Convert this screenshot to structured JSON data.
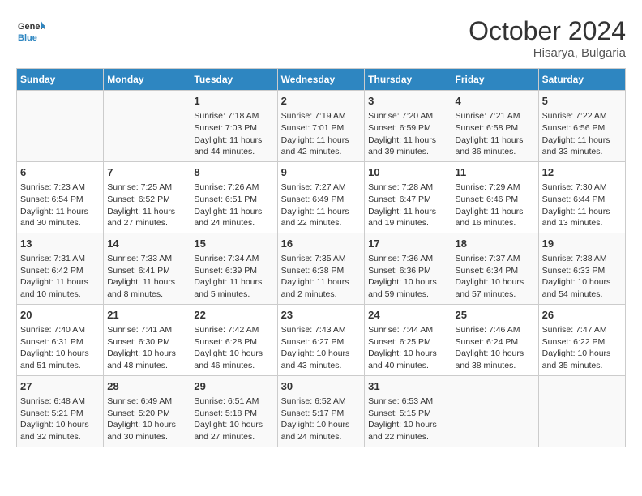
{
  "header": {
    "logo_line1": "General",
    "logo_line2": "Blue",
    "month_year": "October 2024",
    "location": "Hisarya, Bulgaria"
  },
  "days_of_week": [
    "Sunday",
    "Monday",
    "Tuesday",
    "Wednesday",
    "Thursday",
    "Friday",
    "Saturday"
  ],
  "weeks": [
    {
      "cells": [
        {
          "day": "",
          "info": ""
        },
        {
          "day": "",
          "info": ""
        },
        {
          "day": "1",
          "info": "Sunrise: 7:18 AM\nSunset: 7:03 PM\nDaylight: 11 hours and 44 minutes."
        },
        {
          "day": "2",
          "info": "Sunrise: 7:19 AM\nSunset: 7:01 PM\nDaylight: 11 hours and 42 minutes."
        },
        {
          "day": "3",
          "info": "Sunrise: 7:20 AM\nSunset: 6:59 PM\nDaylight: 11 hours and 39 minutes."
        },
        {
          "day": "4",
          "info": "Sunrise: 7:21 AM\nSunset: 6:58 PM\nDaylight: 11 hours and 36 minutes."
        },
        {
          "day": "5",
          "info": "Sunrise: 7:22 AM\nSunset: 6:56 PM\nDaylight: 11 hours and 33 minutes."
        }
      ]
    },
    {
      "cells": [
        {
          "day": "6",
          "info": "Sunrise: 7:23 AM\nSunset: 6:54 PM\nDaylight: 11 hours and 30 minutes."
        },
        {
          "day": "7",
          "info": "Sunrise: 7:25 AM\nSunset: 6:52 PM\nDaylight: 11 hours and 27 minutes."
        },
        {
          "day": "8",
          "info": "Sunrise: 7:26 AM\nSunset: 6:51 PM\nDaylight: 11 hours and 24 minutes."
        },
        {
          "day": "9",
          "info": "Sunrise: 7:27 AM\nSunset: 6:49 PM\nDaylight: 11 hours and 22 minutes."
        },
        {
          "day": "10",
          "info": "Sunrise: 7:28 AM\nSunset: 6:47 PM\nDaylight: 11 hours and 19 minutes."
        },
        {
          "day": "11",
          "info": "Sunrise: 7:29 AM\nSunset: 6:46 PM\nDaylight: 11 hours and 16 minutes."
        },
        {
          "day": "12",
          "info": "Sunrise: 7:30 AM\nSunset: 6:44 PM\nDaylight: 11 hours and 13 minutes."
        }
      ]
    },
    {
      "cells": [
        {
          "day": "13",
          "info": "Sunrise: 7:31 AM\nSunset: 6:42 PM\nDaylight: 11 hours and 10 minutes."
        },
        {
          "day": "14",
          "info": "Sunrise: 7:33 AM\nSunset: 6:41 PM\nDaylight: 11 hours and 8 minutes."
        },
        {
          "day": "15",
          "info": "Sunrise: 7:34 AM\nSunset: 6:39 PM\nDaylight: 11 hours and 5 minutes."
        },
        {
          "day": "16",
          "info": "Sunrise: 7:35 AM\nSunset: 6:38 PM\nDaylight: 11 hours and 2 minutes."
        },
        {
          "day": "17",
          "info": "Sunrise: 7:36 AM\nSunset: 6:36 PM\nDaylight: 10 hours and 59 minutes."
        },
        {
          "day": "18",
          "info": "Sunrise: 7:37 AM\nSunset: 6:34 PM\nDaylight: 10 hours and 57 minutes."
        },
        {
          "day": "19",
          "info": "Sunrise: 7:38 AM\nSunset: 6:33 PM\nDaylight: 10 hours and 54 minutes."
        }
      ]
    },
    {
      "cells": [
        {
          "day": "20",
          "info": "Sunrise: 7:40 AM\nSunset: 6:31 PM\nDaylight: 10 hours and 51 minutes."
        },
        {
          "day": "21",
          "info": "Sunrise: 7:41 AM\nSunset: 6:30 PM\nDaylight: 10 hours and 48 minutes."
        },
        {
          "day": "22",
          "info": "Sunrise: 7:42 AM\nSunset: 6:28 PM\nDaylight: 10 hours and 46 minutes."
        },
        {
          "day": "23",
          "info": "Sunrise: 7:43 AM\nSunset: 6:27 PM\nDaylight: 10 hours and 43 minutes."
        },
        {
          "day": "24",
          "info": "Sunrise: 7:44 AM\nSunset: 6:25 PM\nDaylight: 10 hours and 40 minutes."
        },
        {
          "day": "25",
          "info": "Sunrise: 7:46 AM\nSunset: 6:24 PM\nDaylight: 10 hours and 38 minutes."
        },
        {
          "day": "26",
          "info": "Sunrise: 7:47 AM\nSunset: 6:22 PM\nDaylight: 10 hours and 35 minutes."
        }
      ]
    },
    {
      "cells": [
        {
          "day": "27",
          "info": "Sunrise: 6:48 AM\nSunset: 5:21 PM\nDaylight: 10 hours and 32 minutes."
        },
        {
          "day": "28",
          "info": "Sunrise: 6:49 AM\nSunset: 5:20 PM\nDaylight: 10 hours and 30 minutes."
        },
        {
          "day": "29",
          "info": "Sunrise: 6:51 AM\nSunset: 5:18 PM\nDaylight: 10 hours and 27 minutes."
        },
        {
          "day": "30",
          "info": "Sunrise: 6:52 AM\nSunset: 5:17 PM\nDaylight: 10 hours and 24 minutes."
        },
        {
          "day": "31",
          "info": "Sunrise: 6:53 AM\nSunset: 5:15 PM\nDaylight: 10 hours and 22 minutes."
        },
        {
          "day": "",
          "info": ""
        },
        {
          "day": "",
          "info": ""
        }
      ]
    }
  ]
}
